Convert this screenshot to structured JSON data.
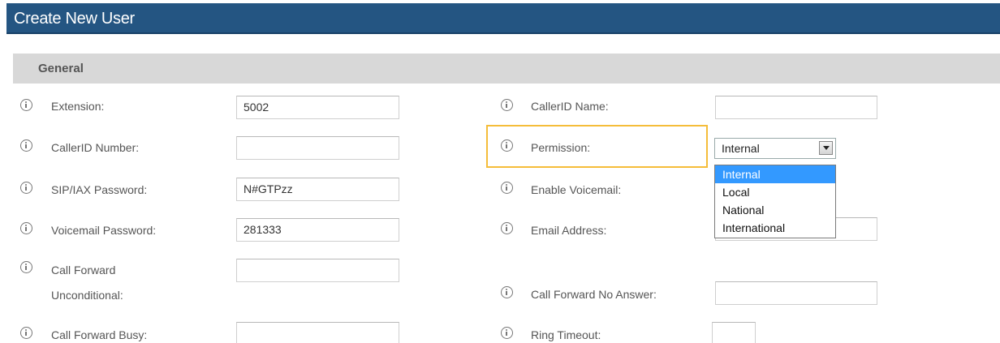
{
  "header": {
    "title": "Create New User"
  },
  "section": {
    "title": "General"
  },
  "fields": {
    "extension": {
      "label": "Extension:",
      "value": "5002"
    },
    "callerid_number": {
      "label": "CallerID Number:",
      "value": ""
    },
    "sip_iax_password": {
      "label": "SIP/IAX Password:",
      "value": "N#GTPzz"
    },
    "voicemail_password": {
      "label": "Voicemail Password:",
      "value": "281333"
    },
    "call_forward_unconditional": {
      "label_line1": "Call Forward",
      "label_line2": "Unconditional:",
      "value": ""
    },
    "call_forward_busy": {
      "label": "Call Forward Busy:",
      "value": ""
    },
    "callerid_name": {
      "label": "CallerID Name:",
      "value": ""
    },
    "permission": {
      "label": "Permission:",
      "selected": "Internal",
      "options": [
        "Internal",
        "Local",
        "National",
        "International"
      ]
    },
    "enable_voicemail": {
      "label": "Enable Voicemail:"
    },
    "email_address": {
      "label": "Email Address:",
      "value": ""
    },
    "call_forward_no_answer": {
      "label": "Call Forward No Answer:",
      "value": ""
    },
    "ring_timeout": {
      "label": "Ring Timeout:",
      "value": ""
    }
  },
  "colors": {
    "header_bg": "#245582",
    "section_bg": "#d8d8d8",
    "highlight": "#f5bd3a",
    "dropdown_selected": "#3399ff"
  },
  "icons": {
    "field_help": "info-icon",
    "select_arrow": "chevron-down-icon"
  }
}
